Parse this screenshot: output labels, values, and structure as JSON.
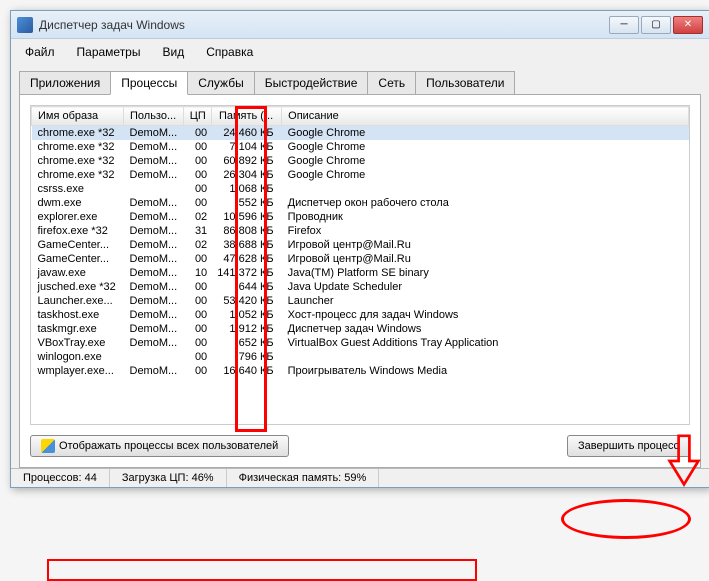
{
  "window": {
    "title": "Диспетчер задач Windows"
  },
  "menu": {
    "file": "Файл",
    "options": "Параметры",
    "view": "Вид",
    "help": "Справка"
  },
  "tabs": {
    "apps": "Приложения",
    "processes": "Процессы",
    "services": "Службы",
    "performance": "Быстродействие",
    "network": "Сеть",
    "users": "Пользователи"
  },
  "columns": {
    "name": "Имя образа",
    "user": "Пользо...",
    "cpu": "ЦП",
    "mem": "Память (...",
    "desc": "Описание"
  },
  "processes": [
    {
      "name": "chrome.exe *32",
      "user": "DemoM...",
      "cpu": "00",
      "mem": "24 460 КБ",
      "desc": "Google Chrome",
      "selected": true
    },
    {
      "name": "chrome.exe *32",
      "user": "DemoM...",
      "cpu": "00",
      "mem": "7 104 КБ",
      "desc": "Google Chrome"
    },
    {
      "name": "chrome.exe *32",
      "user": "DemoM...",
      "cpu": "00",
      "mem": "60 892 КБ",
      "desc": "Google Chrome"
    },
    {
      "name": "chrome.exe *32",
      "user": "DemoM...",
      "cpu": "00",
      "mem": "26 304 КБ",
      "desc": "Google Chrome"
    },
    {
      "name": "csrss.exe",
      "user": "",
      "cpu": "00",
      "mem": "1 068 КБ",
      "desc": ""
    },
    {
      "name": "dwm.exe",
      "user": "DemoM...",
      "cpu": "00",
      "mem": "552 КБ",
      "desc": "Диспетчер окон рабочего стола"
    },
    {
      "name": "explorer.exe",
      "user": "DemoM...",
      "cpu": "02",
      "mem": "10 596 КБ",
      "desc": "Проводник"
    },
    {
      "name": "firefox.exe *32",
      "user": "DemoM...",
      "cpu": "31",
      "mem": "86 808 КБ",
      "desc": "Firefox"
    },
    {
      "name": "GameCenter...",
      "user": "DemoM...",
      "cpu": "02",
      "mem": "38 688 КБ",
      "desc": "Игровой центр@Mail.Ru"
    },
    {
      "name": "GameCenter...",
      "user": "DemoM...",
      "cpu": "00",
      "mem": "47 628 КБ",
      "desc": "Игровой центр@Mail.Ru"
    },
    {
      "name": "javaw.exe",
      "user": "DemoM...",
      "cpu": "10",
      "mem": "141 372 КБ",
      "desc": "Java(TM) Platform SE binary"
    },
    {
      "name": "jusched.exe *32",
      "user": "DemoM...",
      "cpu": "00",
      "mem": "644 КБ",
      "desc": "Java Update Scheduler"
    },
    {
      "name": "Launcher.exe...",
      "user": "DemoM...",
      "cpu": "00",
      "mem": "53 420 КБ",
      "desc": "Launcher"
    },
    {
      "name": "taskhost.exe",
      "user": "DemoM...",
      "cpu": "00",
      "mem": "1 052 КБ",
      "desc": "Хост-процесс для задач Windows"
    },
    {
      "name": "taskmgr.exe",
      "user": "DemoM...",
      "cpu": "00",
      "mem": "1 912 КБ",
      "desc": "Диспетчер задач Windows"
    },
    {
      "name": "VBoxTray.exe",
      "user": "DemoM...",
      "cpu": "00",
      "mem": "652 КБ",
      "desc": "VirtualBox Guest Additions Tray Application"
    },
    {
      "name": "winlogon.exe",
      "user": "",
      "cpu": "00",
      "mem": "796 КБ",
      "desc": ""
    },
    {
      "name": "wmplayer.exe...",
      "user": "DemoM...",
      "cpu": "00",
      "mem": "16 640 КБ",
      "desc": "Проигрыватель Windows Media"
    }
  ],
  "buttons": {
    "show_all": "Отображать процессы всех пользователей",
    "end_process": "Завершить процесс"
  },
  "status": {
    "processes": "Процессов: 44",
    "cpu": "Загрузка ЦП: 46%",
    "mem": "Физическая память: 59%"
  }
}
